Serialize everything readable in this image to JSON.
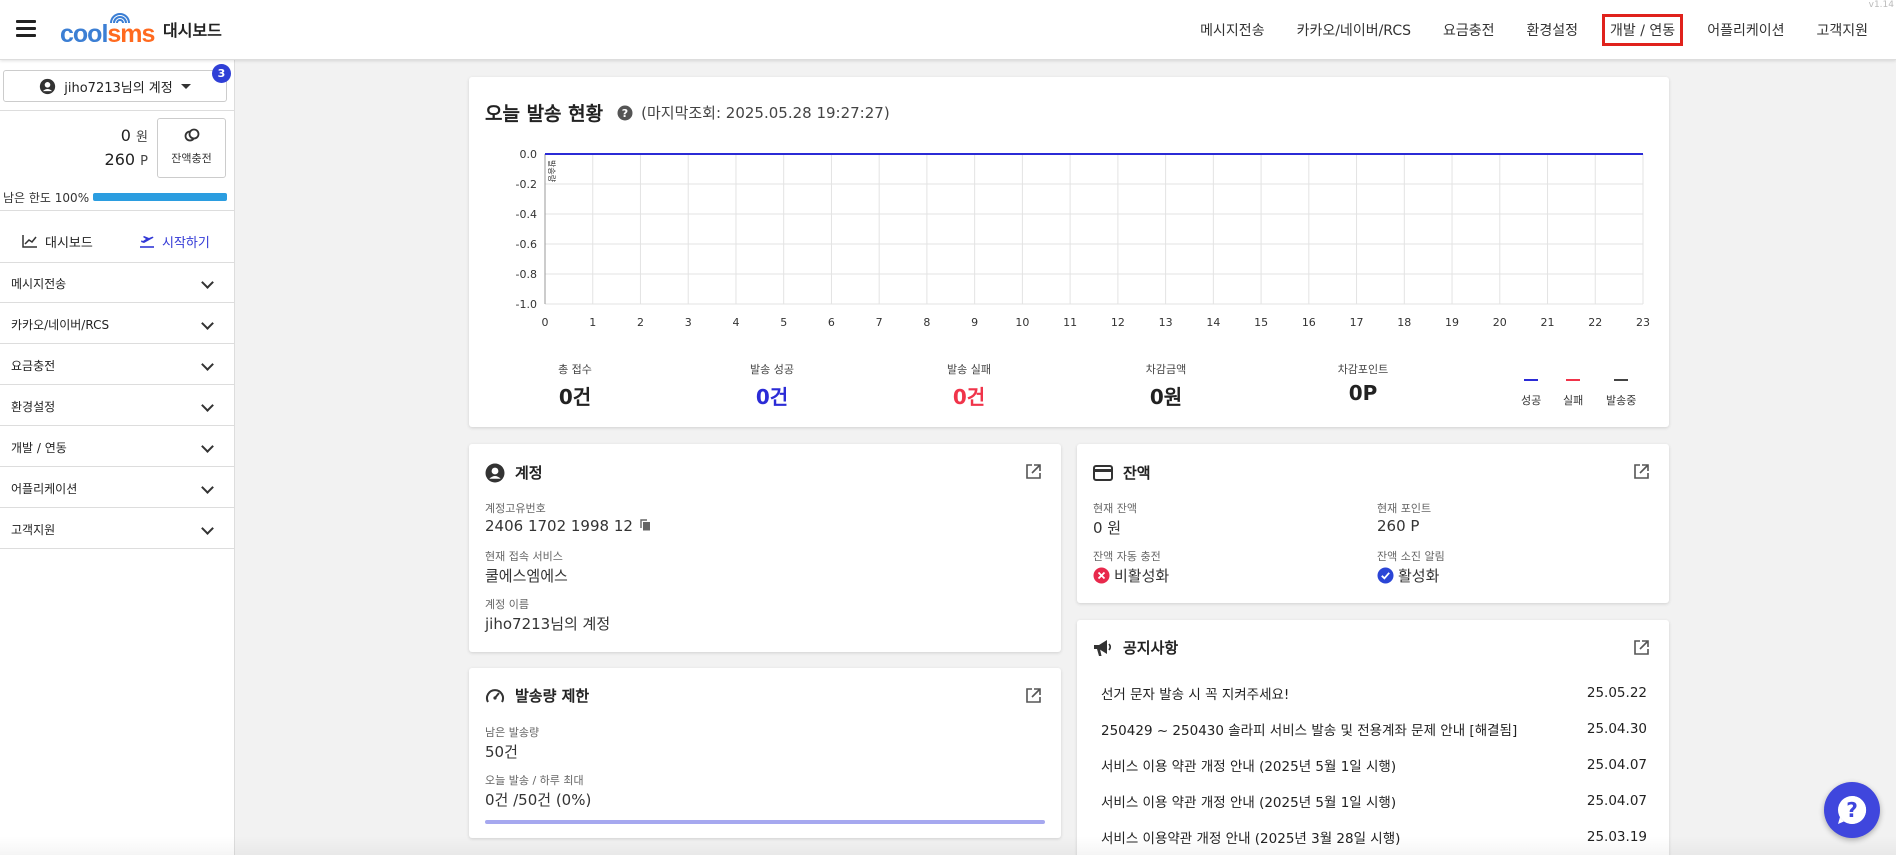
{
  "version": "v1.14",
  "header": {
    "app_title": "대시보드",
    "logo": "coolsms",
    "nav": [
      "메시지전송",
      "카카오/네이버/RCS",
      "요금충전",
      "환경설정",
      "개발 / 연동",
      "어플리케이션",
      "고객지원"
    ],
    "active_nav": "개발 / 연동"
  },
  "sidebar": {
    "account_label": "jiho7213님의 계정",
    "notification_count": "3",
    "balance_won": "0",
    "won_unit": "원",
    "balance_point": "260",
    "point_unit": "P",
    "charge_label": "잔액충전",
    "limit_label": "남은 한도 100%",
    "limit_fraction": 1.0,
    "tab_dashboard": "대시보드",
    "tab_start": "시작하기",
    "menus": [
      "메시지전송",
      "카카오/네이버/RCS",
      "요금충전",
      "환경설정",
      "개발 / 연동",
      "어플리케이션",
      "고객지원"
    ]
  },
  "today": {
    "title": "오늘 발송 현황",
    "last_query": "(마지막조회: 2025.05.28 19:27:27)",
    "chart_data": {
      "type": "line",
      "x": [
        0,
        1,
        2,
        3,
        4,
        5,
        6,
        7,
        8,
        9,
        10,
        11,
        12,
        13,
        14,
        15,
        16,
        17,
        18,
        19,
        20,
        21,
        22,
        23
      ],
      "series": [
        {
          "name": "성공",
          "color": "#2b2bd6",
          "values": [
            0,
            0,
            0,
            0,
            0,
            0,
            0,
            0,
            0,
            0,
            0,
            0,
            0,
            0,
            0,
            0,
            0,
            0,
            0,
            0,
            0,
            0,
            0,
            0
          ]
        }
      ],
      "ylabel": "발송량",
      "ylim": [
        -1.0,
        0.0
      ],
      "yticks": [
        "0.0",
        "-0.2",
        "-0.4",
        "-0.6",
        "-0.8",
        "-1.0"
      ],
      "xticks": [
        "0",
        "1",
        "2",
        "3",
        "4",
        "5",
        "6",
        "7",
        "8",
        "9",
        "10",
        "11",
        "12",
        "13",
        "14",
        "15",
        "16",
        "17",
        "18",
        "19",
        "20",
        "21",
        "22",
        "23"
      ],
      "grid": true
    },
    "stats": [
      {
        "label": "총 접수",
        "value": "0건",
        "color": "#222222"
      },
      {
        "label": "발송 성공",
        "value": "0건",
        "color": "#2b2bd6"
      },
      {
        "label": "발송 실패",
        "value": "0건",
        "color": "#f0344a"
      },
      {
        "label": "차감금액",
        "value": "0원",
        "color": "#222222"
      },
      {
        "label": "차감포인트",
        "value": "0P",
        "color": "#222222"
      }
    ],
    "legend": [
      {
        "label": "성공",
        "color": "#2b2bd6"
      },
      {
        "label": "실패",
        "color": "#f0344a"
      },
      {
        "label": "발송중",
        "color": "#444444"
      }
    ]
  },
  "account": {
    "title": "계정",
    "id_label": "계정고유번호",
    "id_value": "2406 1702 1998 12",
    "service_label": "현재 접속 서비스",
    "service_value": "쿨에스엠에스",
    "name_label": "계정 이름",
    "name_value": "jiho7213님의 계정"
  },
  "balance": {
    "title": "잔액",
    "current_label": "현재 잔액",
    "current_value": "0 원",
    "point_label": "현재 포인트",
    "point_value": "260 P",
    "auto_label": "잔액 자동 충전",
    "auto_value": "비활성화",
    "alert_label": "잔액 소진 알림",
    "alert_value": "활성화"
  },
  "limit": {
    "title": "발송량 제한",
    "remain_label": "남은 발송량",
    "remain_value": "50건",
    "today_label": "오늘 발송 / 하루 최대",
    "today_value": "0건 /50건 (0%)",
    "progress_fraction": 0.0
  },
  "notice": {
    "title": "공지사항",
    "items": [
      {
        "title": "선거 문자 발송 시 꼭 지켜주세요!",
        "date": "25.05.22"
      },
      {
        "title": "250429 ~ 250430 솔라피 서비스 발송 및 전용계좌 문제 안내 [해결됨]",
        "date": "25.04.30"
      },
      {
        "title": "서비스 이용 약관 개정 안내 (2025년 5월 1일 시행)",
        "date": "25.04.07"
      },
      {
        "title": "서비스 이용 약관 개정 안내 (2025년 5월 1일 시행)",
        "date": "25.04.07"
      },
      {
        "title": "서비스 이용약관 개정 안내 (2025년 3월 28일 시행)",
        "date": "25.03.19"
      }
    ]
  }
}
